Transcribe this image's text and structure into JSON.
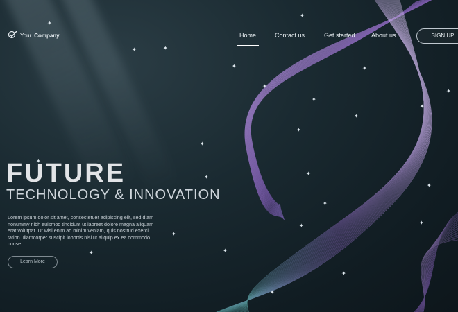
{
  "brand": {
    "prefix": "Your",
    "name": "Company"
  },
  "nav": {
    "items": [
      "Home",
      "Contact us",
      "Get started",
      "About us"
    ],
    "active": "Home",
    "signup": "SIGN UP"
  },
  "hero": {
    "title": "FUTURE",
    "subtitle": "TECHNOLOGY & INNOVATION",
    "body": "Lorem ipsum dolor sit amet, consectetuer adipiscing elit, sed diam nonummy nibh euismod tincidunt ut laoreet dolore magna aliquam erat volutpat. Ut wisi enim ad minim veniam, quis nostrud exerci tation ullamcorper suscipit lobortis nisl ut aliquip ex ea commodo conse",
    "cta": "Learn More"
  },
  "colors": {
    "background": "#14232a",
    "wave_purple": "#9a6fd0",
    "wave_teal": "#7fd0c8",
    "text": "#e2e4e7"
  },
  "icons": [
    "checkmark-logo-icon",
    "star-icon"
  ]
}
